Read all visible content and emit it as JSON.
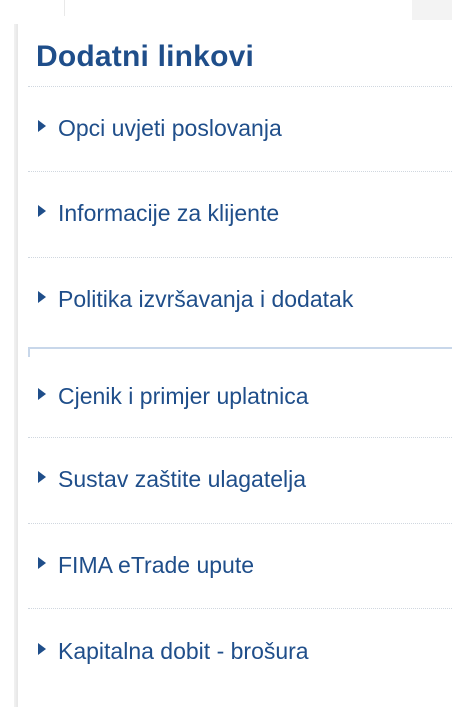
{
  "sidebar_panel": {
    "title": "Dodatni linkovi",
    "links": [
      {
        "label": "Opci uvjeti poslovanja"
      },
      {
        "label": "Informacije za klijente"
      },
      {
        "label": "Politika izvršavanja i dodatak"
      },
      {
        "label": "Cjenik i primjer uplatnica"
      },
      {
        "label": "Sustav zaštite ulagatelja"
      },
      {
        "label": "FIMA eTrade upute"
      },
      {
        "label": "Kapitalna dobit - brošura"
      }
    ]
  },
  "colors": {
    "link": "#1f4e8a",
    "title": "#1f4e8a",
    "divider": "#d0d7df",
    "active_bar": "#c8d7ea"
  },
  "icons": {
    "bullet": "triangle-right-icon"
  }
}
